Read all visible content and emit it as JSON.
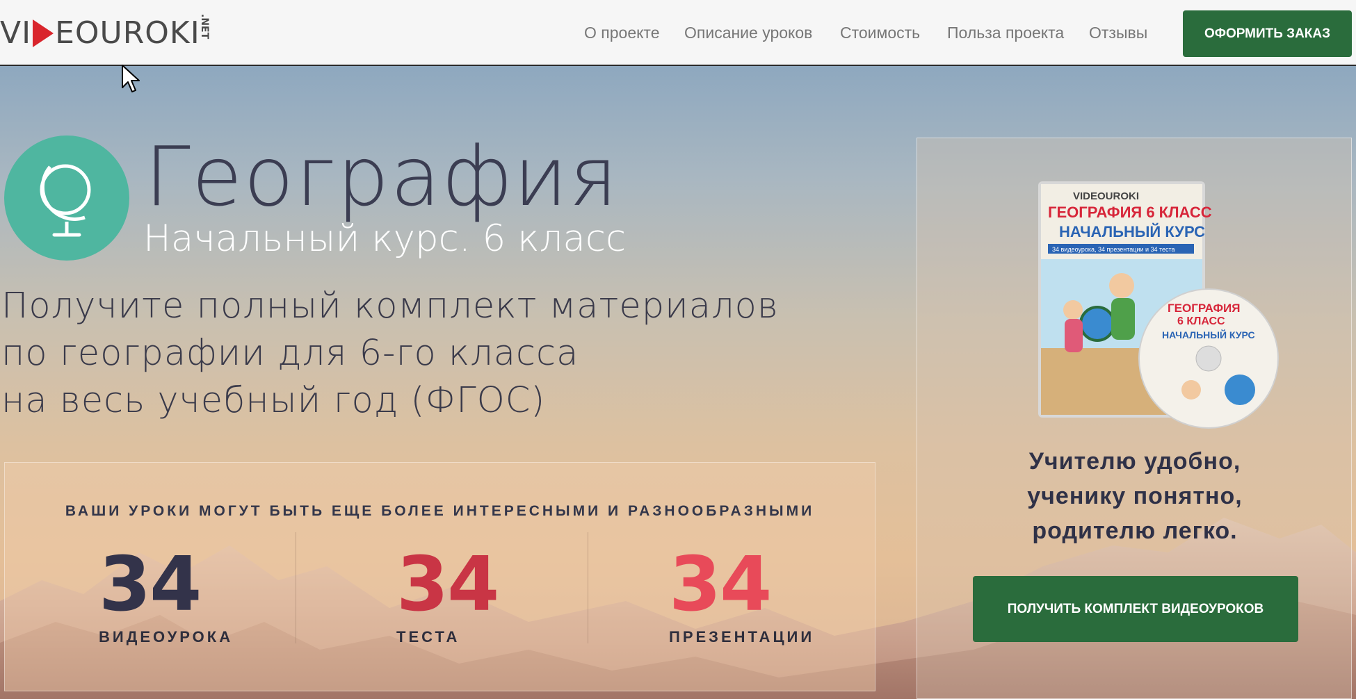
{
  "header": {
    "logo_main": "VIDEOUROKI",
    "logo_prefix": "VI",
    "logo_suffix": "EOUROKI",
    "logo_domain": ".NET",
    "nav": [
      "О проекте",
      "Описание уроков",
      "Стоимость",
      "Польза проекта",
      "Отзывы"
    ],
    "order_button": "ОФОРМИТЬ ЗАКАЗ"
  },
  "hero": {
    "title": "География",
    "subtitle": "Начальный курс. 6 класс",
    "lead_lines": [
      "Получите полный комплект материалов",
      "по географии для 6-го класса",
      "на весь учебный год (ФГОС)"
    ],
    "icon": "globe-icon",
    "stats": {
      "heading": "ВАШИ УРОКИ МОГУТ БЫТЬ ЕЩЕ БОЛЕЕ ИНТЕРЕСНЫМИ И РАЗНООБРАЗНЫМИ",
      "items": [
        {
          "number": "34",
          "label": "ВИДЕОУРОКА",
          "color": "#33334a"
        },
        {
          "number": "34",
          "label": "ТЕСТА",
          "color": "#c93545"
        },
        {
          "number": "34",
          "label": "ПРЕЗЕНТАЦИИ",
          "color": "#e84a59"
        }
      ]
    }
  },
  "side": {
    "product": {
      "brand": "VIDEOUROKI",
      "title_line1": "ГЕОГРАФИЯ 6 КЛАСС",
      "title_line2": "НАЧАЛЬНЫЙ КУРС",
      "small": "34 видеоурока, 34 презентации и 34 теста",
      "disc_line1": "ГЕОГРАФИЯ",
      "disc_line2": "6 КЛАСС",
      "disc_line3": "НАЧАЛЬНЫЙ КУРС"
    },
    "tagline": [
      "Учителю удобно,",
      "ученику понятно,",
      "родителю легко."
    ],
    "button": "ПОЛУЧИТЬ КОМПЛЕКТ ВИДЕОУРОКОВ"
  },
  "colors": {
    "accent_green": "#2a6c3c",
    "teal_circle": "#4fb6a0",
    "title_navy": "#3b3d52",
    "logo_red": "#d9252c"
  }
}
